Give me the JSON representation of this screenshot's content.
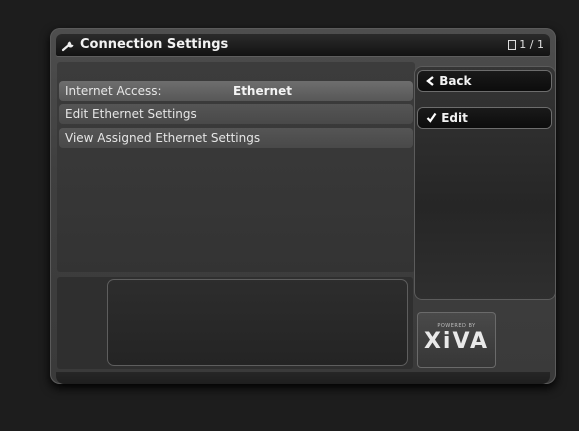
{
  "titlebar": {
    "title": "Connection Settings",
    "page_indicator": "1 / 1",
    "icon": "wrench-icon",
    "page_icon": "page-icon"
  },
  "list": {
    "items": [
      {
        "label": "Internet Access:",
        "value": "Ethernet",
        "selected": true
      },
      {
        "label": "Edit Ethernet Settings",
        "value": "",
        "selected": false
      },
      {
        "label": "View Assigned Ethernet Settings",
        "value": "",
        "selected": false
      }
    ]
  },
  "side_menu": {
    "back_icon": "chevron-left-icon",
    "back_label": "Back",
    "edit_icon": "checkmark-icon",
    "edit_label": "Edit"
  },
  "branding": {
    "powered_by": "POWERED BY",
    "logo_text": "XiVA"
  }
}
